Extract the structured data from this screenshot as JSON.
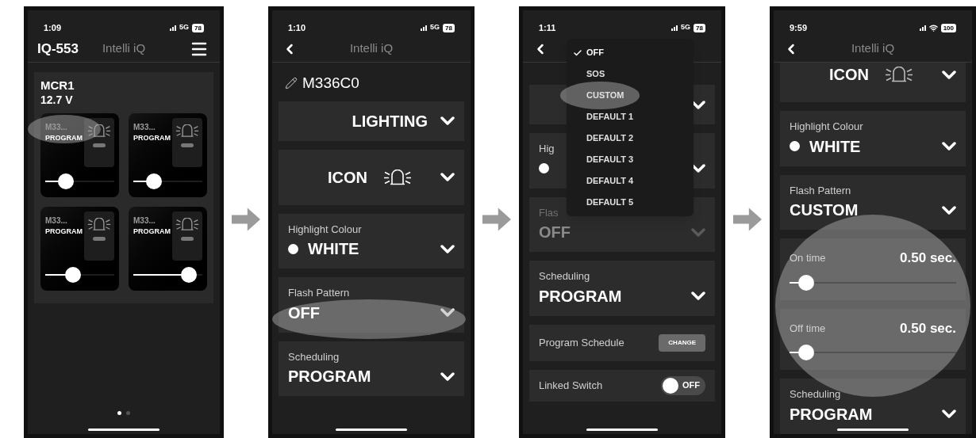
{
  "phones": [
    {
      "kind": "dashboard",
      "status": {
        "time": "1:09",
        "network": "5G",
        "battery": "78"
      },
      "header": {
        "device": "IQ-553",
        "title": "Intelli iQ"
      },
      "panel": {
        "name": "MCR1",
        "voltage": "12.7 V",
        "tiles": [
          {
            "name": "M33...",
            "mode": "PROGRAM",
            "level": 0.3,
            "circled": true
          },
          {
            "name": "M33...",
            "mode": "PROGRAM",
            "level": 0.3,
            "circled": false
          },
          {
            "name": "M33...",
            "mode": "PROGRAM",
            "level": 0.4,
            "circled": false
          },
          {
            "name": "M33...",
            "mode": "PROGRAM",
            "level": 0.8,
            "circled": false
          }
        ]
      },
      "page_dots": [
        {
          "selected": true
        },
        {
          "selected": false
        }
      ]
    },
    {
      "kind": "settings",
      "status": {
        "time": "1:10",
        "network": "5G",
        "battery": "78"
      },
      "header": {
        "title": "Intelli iQ"
      },
      "device_name": "M336C0",
      "rows": [
        {
          "kind": "select",
          "value": "LIGHTING",
          "disabled": false,
          "circled": false
        },
        {
          "kind": "icon-select",
          "value": "ICON",
          "disabled": false,
          "circled": false
        },
        {
          "kind": "color-select",
          "label": "Highlight Colour",
          "value": "WHITE",
          "disabled": false,
          "circled": false
        },
        {
          "kind": "select",
          "label": "Flash Pattern",
          "value": "OFF",
          "disabled": false,
          "circled": true
        },
        {
          "kind": "select",
          "label": "Scheduling",
          "value": "PROGRAM",
          "disabled": false,
          "circled": false
        }
      ]
    },
    {
      "kind": "settings",
      "status": {
        "time": "1:11",
        "network": "5G",
        "battery": "78"
      },
      "rows": [
        {
          "kind": "select",
          "disabled": false,
          "circled": false
        },
        {
          "kind": "color-select",
          "label": "Hig",
          "disabled": false,
          "circled": false
        },
        {
          "kind": "select",
          "label": "Flas",
          "value": "OFF",
          "disabled": true,
          "circled": false
        },
        {
          "kind": "select",
          "label": "Scheduling",
          "value": "PROGRAM",
          "disabled": false,
          "circled": false
        },
        {
          "kind": "button",
          "label": "Program Schedule",
          "button": "CHANGE",
          "disabled": false,
          "circled": false
        },
        {
          "kind": "toggle",
          "label": "Linked Switch",
          "on": false,
          "state_text": "OFF",
          "disabled": false,
          "circled": false
        }
      ],
      "menu": {
        "options": [
          {
            "label": "OFF",
            "selected": true,
            "circled": false
          },
          {
            "label": "SOS",
            "selected": false,
            "circled": false
          },
          {
            "label": "CUSTOM",
            "selected": false,
            "circled": true
          },
          {
            "label": "DEFAULT 1",
            "selected": false,
            "circled": false
          },
          {
            "label": "DEFAULT 2",
            "selected": false,
            "circled": false
          },
          {
            "label": "DEFAULT 3",
            "selected": false,
            "circled": false
          },
          {
            "label": "DEFAULT 4",
            "selected": false,
            "circled": false
          },
          {
            "label": "DEFAULT 5",
            "selected": false,
            "circled": false
          }
        ]
      }
    },
    {
      "kind": "settings",
      "scrolled": true,
      "status": {
        "time": "9:59",
        "battery": "100"
      },
      "header": {
        "title": "Intelli iQ"
      },
      "rows": [
        {
          "kind": "icon-select",
          "value": "ICON",
          "disabled": false,
          "circled": false
        },
        {
          "kind": "color-select",
          "label": "Highlight Colour",
          "value": "WHITE",
          "disabled": false,
          "circled": false
        },
        {
          "kind": "select",
          "label": "Flash Pattern",
          "value": "CUSTOM",
          "disabled": false,
          "circled": false
        },
        {
          "kind": "slider",
          "label": "On time",
          "reading": "0.50 sec.",
          "level": 0.1,
          "disabled": false,
          "circled": true
        },
        {
          "kind": "slider",
          "label": "Off time",
          "reading": "0.50 sec.",
          "level": 0.1,
          "disabled": false,
          "circled": true
        },
        {
          "kind": "select",
          "label": "Scheduling",
          "value": "PROGRAM",
          "disabled": false,
          "circled": false
        }
      ]
    }
  ]
}
